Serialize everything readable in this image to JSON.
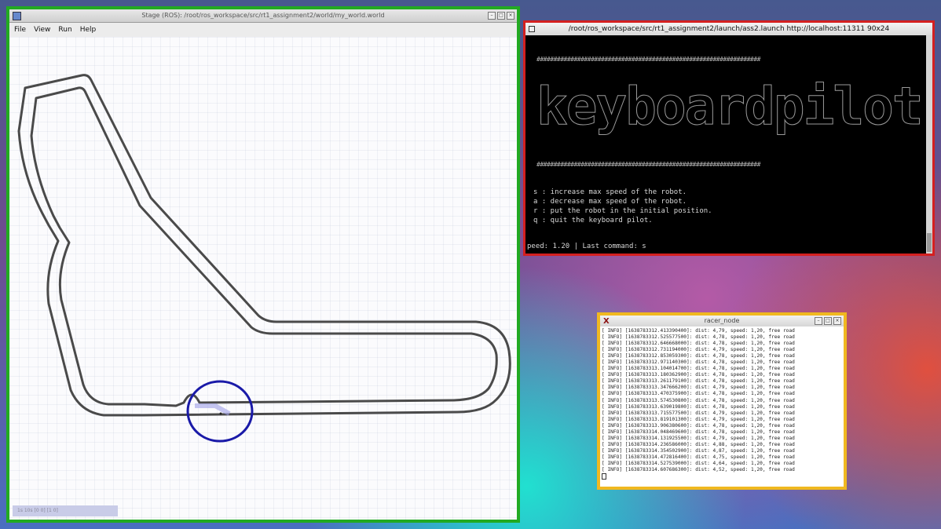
{
  "stage": {
    "title": "Stage (ROS): /root/ros_workspace/src/rt1_assignment2/world/my_world.world",
    "menu": [
      "File",
      "View",
      "Run",
      "Help"
    ],
    "status": "1s 10s [0 0] [1 0]",
    "highlight_color": "#22aa22",
    "robot_marker_color": "#1a1aa8"
  },
  "terminal": {
    "title": "/root/ros_workspace/src/rt1_assignment2/launch/ass2.launch http://localhost:11311 90x24",
    "hash_line": "##################################################################",
    "banner": "keyboardpilot",
    "commands": [
      "s : increase max speed of the robot.",
      "a : decrease max speed of the robot.",
      "r : put the robot in the initial position.",
      "q : quit the keyboard pilot."
    ],
    "status_line": "peed: 1.20 | Last command: s",
    "highlight_color": "#d42020"
  },
  "racer": {
    "title": "racer_node",
    "highlight_color": "#f0b820",
    "logs": [
      "[ INFO] [1638783312.413390400]: dist: 4,79, speed: 1,20, free road",
      "[ INFO] [1638783312.525577500]: dist: 4,78, speed: 1,20, free road",
      "[ INFO] [1638783312.646668000]: dist: 4,78, speed: 1,20, free road",
      "[ INFO] [1638783312.731194000]: dist: 4,79, speed: 1,20, free road",
      "[ INFO] [1638783312.853059300]: dist: 4,78, speed: 1,20, free road",
      "[ INFO] [1638783312.971140300]: dist: 4,78, speed: 1,20, free road",
      "[ INFO] [1638783313.104014700]: dist: 4,78, speed: 1,20, free road",
      "[ INFO] [1638783313.180362900]: dist: 4,78, speed: 1,20, free road",
      "[ INFO] [1638783313.261179100]: dist: 4,78, speed: 1,20, free road",
      "[ INFO] [1638783313.347666200]: dist: 4,79, speed: 1,20, free road",
      "[ INFO] [1638783313.470375900]: dist: 4,78, speed: 1,20, free road",
      "[ INFO] [1638783313.574530800]: dist: 4,78, speed: 1,20, free road",
      "[ INFO] [1638783313.639019800]: dist: 4,78, speed: 1,20, free road",
      "[ INFO] [1638783313.715577500]: dist: 4,79, speed: 1,20, free road",
      "[ INFO] [1638783313.819101300]: dist: 4,79, speed: 1,20, free road",
      "[ INFO] [1638783313.906380600]: dist: 4,78, speed: 1,20, free road",
      "[ INFO] [1638783314.048469600]: dist: 4,78, speed: 1,20, free road",
      "[ INFO] [1638783314.131925500]: dist: 4,79, speed: 1,20, free road",
      "[ INFO] [1638783314.236586000]: dist: 4,88, speed: 1,20, free road",
      "[ INFO] [1638783314.354502900]: dist: 4,87, speed: 1,20, free road",
      "[ INFO] [1638783314.472816400]: dist: 4,75, speed: 1,20, free road",
      "[ INFO] [1638783314.527539000]: dist: 4,64, speed: 1,20, free road",
      "[ INFO] [1638783314.607686300]: dist: 4,52, speed: 1,20, free road"
    ]
  }
}
